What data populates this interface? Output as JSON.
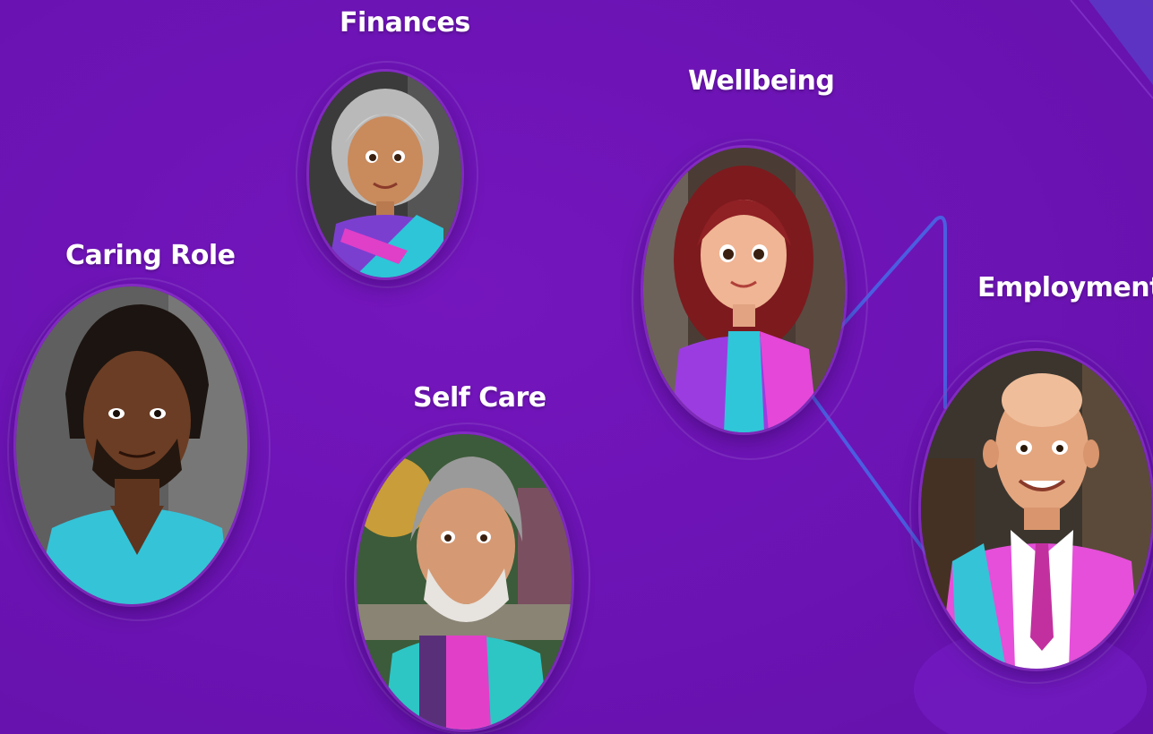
{
  "colors": {
    "background": "#6d14b6",
    "accent_line": "#4b5de0",
    "label_text": "#ffffff",
    "teal": "#31c6dc",
    "magenta": "#e040d8"
  },
  "topics": [
    {
      "label": "Finances",
      "avatar": "elderly-woman-avatar"
    },
    {
      "label": "Wellbeing",
      "avatar": "red-haired-woman-avatar"
    },
    {
      "label": "Caring Role",
      "avatar": "dreadlocked-man-avatar"
    },
    {
      "label": "Self Care",
      "avatar": "bearded-older-man-avatar"
    },
    {
      "label": "Employment",
      "avatar": "bald-man-avatar"
    }
  ]
}
